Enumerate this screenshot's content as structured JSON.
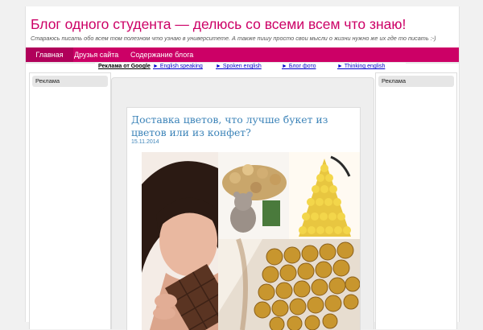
{
  "header": {
    "title": "Блог одного студента — делюсь со всеми всем что знаю!",
    "description": "Стараюсь писать обо всем том полезном что узнаю в университете. А также пишу просто свои мысли о жизни нужно же их где то писать :-)"
  },
  "nav": {
    "items": [
      {
        "label": "Главная",
        "active": true
      },
      {
        "label": "Друзья сайта",
        "active": false
      },
      {
        "label": "Содержание блога",
        "active": false
      }
    ]
  },
  "adlinks": {
    "label": "Реклама от Google",
    "links": [
      "► English speaking",
      "► Spoken english",
      "► Блог фото",
      "► Thinking english"
    ]
  },
  "sidebars": {
    "left_title": "Реклама",
    "right_title": "Реклама"
  },
  "post": {
    "title": "Доставка цветов, что лучше букет из цветов или из конфет?",
    "date": "15.11.2014"
  },
  "colors": {
    "brand": "#cc0066",
    "link": "#3b83b8"
  }
}
